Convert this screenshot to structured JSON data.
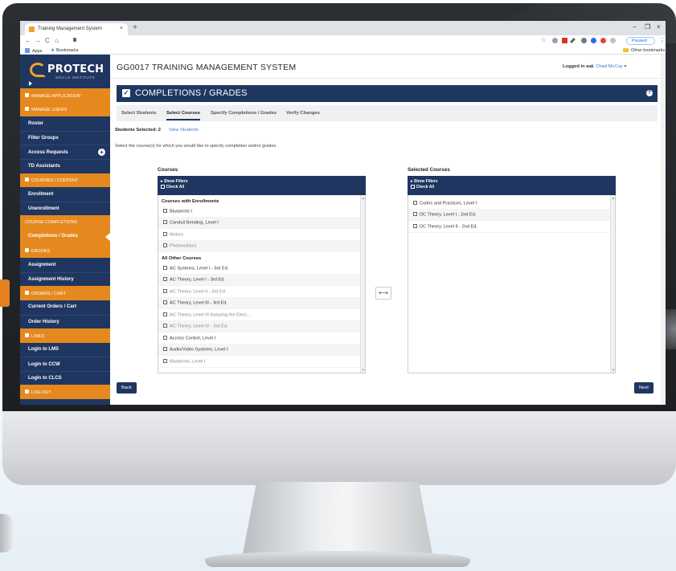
{
  "browser": {
    "tab_title": "Training Management System",
    "tab_close": "×",
    "new_tab": "+",
    "window_controls": [
      "−",
      "❐",
      "×"
    ],
    "nav_buttons": [
      "←",
      "→",
      "C",
      "⌂"
    ],
    "address_icon": "lock-icon",
    "paused_label": "Paused",
    "bookmarks": {
      "apps": "Apps",
      "bookmarks": "Bookmarks",
      "other": "Other bookmarks"
    }
  },
  "logo": {
    "name": "PROTECH",
    "subtitle": "SKILLS INSTITUTE"
  },
  "sidebar": {
    "items": [
      {
        "label": "MANAGE APPLICATION",
        "type": "section"
      },
      {
        "label": "MANAGE USERS",
        "type": "section"
      },
      {
        "label": "Roster",
        "type": "sub"
      },
      {
        "label": "Filter Groups",
        "type": "sub"
      },
      {
        "label": "Access Requests",
        "type": "sub",
        "icon": "plus-circle-icon"
      },
      {
        "label": "TD Assistants",
        "type": "sub"
      },
      {
        "label": "COURSES / CONTENT",
        "type": "section"
      },
      {
        "label": "Enrollment",
        "type": "sub"
      },
      {
        "label": "Unenrollment",
        "type": "sub"
      },
      {
        "label": "COURSE COMPLETIONS",
        "type": "section-plain"
      },
      {
        "label": "Completions / Grades",
        "type": "sub",
        "active": true
      },
      {
        "label": "EBOOKS",
        "type": "section"
      },
      {
        "label": "Assignment",
        "type": "sub"
      },
      {
        "label": "Assignment History",
        "type": "sub"
      },
      {
        "label": "ORDERS / CART",
        "type": "section"
      },
      {
        "label": "Current Orders / Cart",
        "type": "sub"
      },
      {
        "label": "Order History",
        "type": "sub"
      },
      {
        "label": "LINKS",
        "type": "section"
      },
      {
        "label": "Login to LMS",
        "type": "sub"
      },
      {
        "label": "Login to CCW",
        "type": "sub"
      },
      {
        "label": "Login to CLCS",
        "type": "sub"
      },
      {
        "label": "LOG OUT",
        "type": "section"
      }
    ]
  },
  "header": {
    "title": "GG0017  TRAINING MANAGEMENT SYSTEM",
    "logged_in_label": "Logged in as:",
    "user_name": "Chad McCoy"
  },
  "banner": {
    "title": "COMPLETIONS / GRADES",
    "help": "?"
  },
  "steps": [
    {
      "label": "Select Students",
      "active": false
    },
    {
      "label": "Select Courses",
      "active": true
    },
    {
      "label": "Specify Completions / Grades",
      "active": false
    },
    {
      "label": "Verify Changes",
      "active": false
    }
  ],
  "selection": {
    "students_selected": "Students Selected: 2",
    "view_students": "View Students",
    "instruction": "Select the course(s) for which you would like to specify completion and/or grades."
  },
  "courses": {
    "heading": "Courses",
    "show_filters": "▸ Show Filters",
    "check_all": "Check All",
    "enrolled_title": "Courses with Enrollments",
    "enrolled": [
      "Blueprints I",
      "Conduit Bending, Level I",
      "Motors",
      "Photovoltaics"
    ],
    "other_title": "All Other Courses",
    "other": [
      "AC Systems, Level I - 3rd Ed.",
      "AC Theory, Level I - 3rd Ed.",
      "AC Theory, Level II - 3rd Ed.",
      "AC Theory, Level III - 3rd Ed.",
      "AC Theory, Level III featuring the Elect...",
      "AC Theory, Level IV - 3rd Ed.",
      "Access Control, Level I",
      "Audio/Video Systems, Level I",
      "Blueprints, Level I"
    ]
  },
  "selected_courses": {
    "heading": "Selected Courses",
    "show_filters": "▸ Show Filters",
    "check_all": "Check All",
    "items": [
      "Codes and Practices, Level I",
      "DC Theory, Level I - 2nd Ed.",
      "DC Theory, Level II - 2nd Ed."
    ]
  },
  "actions": {
    "transfer": "⟷",
    "back": "Back",
    "next": "Next"
  },
  "colors": {
    "navy": "#1f3660",
    "orange": "#e5891f",
    "link": "#3c7bc6"
  }
}
